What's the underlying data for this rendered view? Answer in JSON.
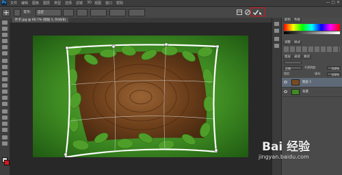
{
  "app": {
    "logo": "Ps"
  },
  "menubar": {
    "items": [
      "文件",
      "编辑",
      "图像",
      "图层",
      "类型",
      "选择",
      "滤镜",
      "3D",
      "视图",
      "窗口",
      "帮助"
    ],
    "window_buttons": "— ▢ ✕"
  },
  "options": {
    "mode_label": "变形:",
    "mode_value": "自定"
  },
  "document": {
    "tab": "叶子.jpg @ 66.7% (图层 1, RGB/8)"
  },
  "panels": {
    "tabs_top": [
      "颜色",
      "色板"
    ],
    "tabs_mid": [
      "调整",
      "样式"
    ],
    "tabs_layers": [
      "图层",
      "通道",
      "路径"
    ],
    "blend_mode": "正常",
    "opacity_label": "不透明度:",
    "opacity_value": "100%",
    "lock_label": "锁定:",
    "fill_label": "填充:",
    "fill_value": "100%",
    "layers": [
      {
        "name": "图层 1",
        "thumb": "#7a4b22"
      },
      {
        "name": "背景",
        "thumb": "#3f8a22"
      }
    ]
  },
  "watermark": {
    "logo": "Bai 经验",
    "url": "jingyan.baidu.com"
  },
  "colors": {
    "highlight": "#d4181b",
    "foreground": "#c9c9c9",
    "background": "#d4181b"
  },
  "icons": [
    "move-icon",
    "warp-icon",
    "cancel-icon",
    "confirm-check-icon",
    "eye-icon",
    "paw-icon"
  ]
}
